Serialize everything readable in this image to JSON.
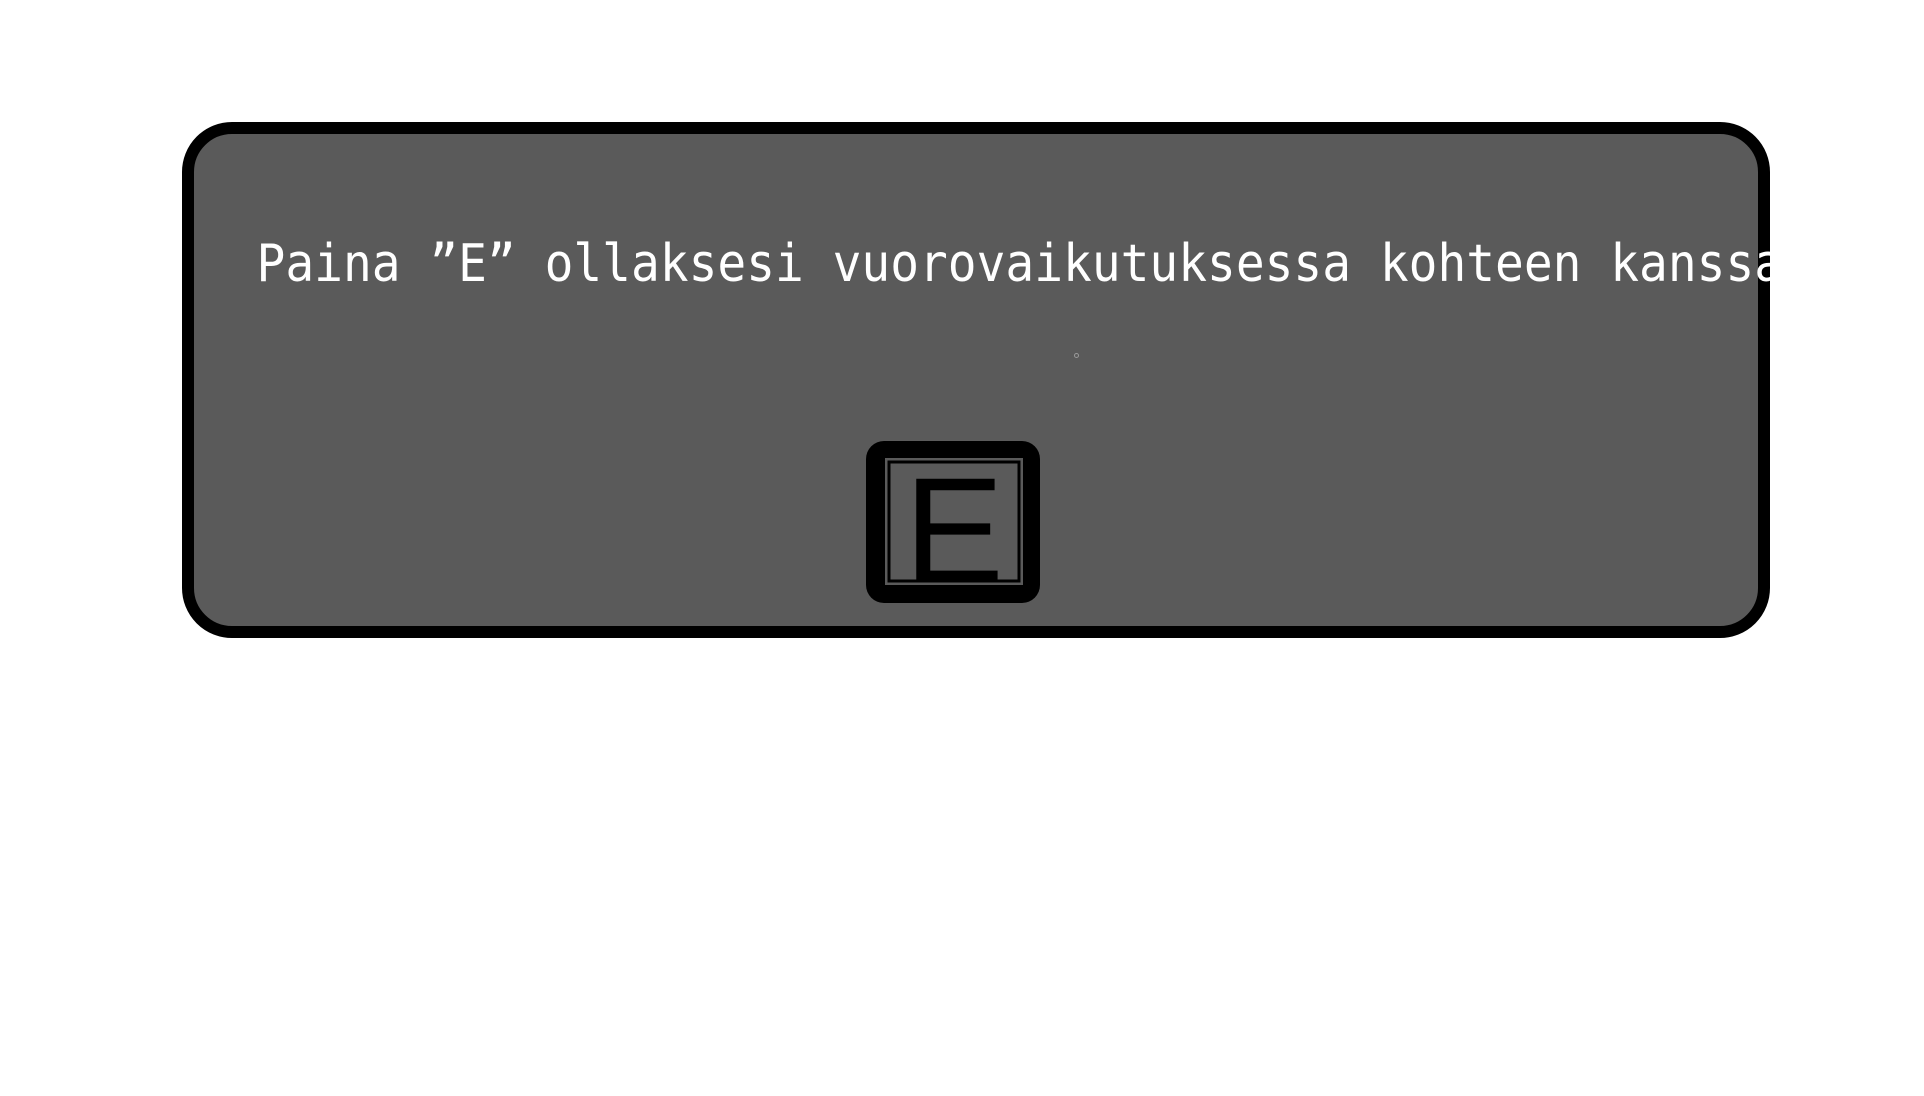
{
  "interaction_prompt": {
    "text": "Paina ”E” ollaksesi vuorovaikutuksessa kohteen kanssa",
    "key_icon": "e-key-icon",
    "key_label": "E",
    "cursor_icon": "crosshair-dot-icon"
  },
  "colors": {
    "background": "#ffffff",
    "panel_fill": "#5a5a5a",
    "panel_border": "#000000",
    "text": "#ffffff"
  }
}
